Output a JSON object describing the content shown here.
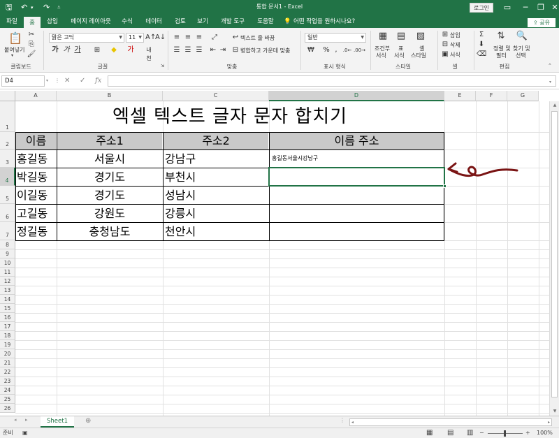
{
  "titlebar": {
    "title": "통합 문서1 - Excel",
    "login": "로그인",
    "save_icon": "save-icon",
    "undo_icon": "undo-icon",
    "redo_icon": "redo-icon"
  },
  "tabs": [
    "파일",
    "홈",
    "삽입",
    "페이지 레이아웃",
    "수식",
    "데이터",
    "검토",
    "보기",
    "개발 도구",
    "도움말"
  ],
  "tellme": "어떤 작업을 원하시나요?",
  "share": "공유",
  "ribbon": {
    "paste": "붙여넣기",
    "font_name": "맑은 고딕",
    "font_size": "11",
    "wrap_text": "텍스트 줄 바꿈",
    "merge_center": "병합하고 가운데 맞춤",
    "number_format": "일반",
    "cond_format": "조건부",
    "cond_format2": "서식",
    "format_table": "표",
    "format_table2": "서식",
    "cell_styles": "셀",
    "cell_styles2": "스타일",
    "insert": "삽입",
    "delete": "삭제",
    "format": "서식",
    "sort_filter": "정렬 및",
    "sort_filter2": "필터",
    "find_select": "찾기 및",
    "find_select2": "선택",
    "groups": {
      "clipboard": "클립보드",
      "font": "글꼴",
      "alignment": "맞춤",
      "number": "표시 형식",
      "styles": "스타일",
      "cells": "셀",
      "editing": "편집"
    }
  },
  "formula_bar": {
    "name_box": "D4",
    "formula": ""
  },
  "columns": [
    "A",
    "B",
    "C",
    "D",
    "E",
    "F",
    "G"
  ],
  "rows": [
    "1",
    "2",
    "3",
    "4",
    "5",
    "6",
    "7",
    "8",
    "9",
    "10",
    "11",
    "12",
    "13",
    "14",
    "15",
    "16",
    "17",
    "18",
    "19",
    "20",
    "21",
    "22",
    "23",
    "24",
    "25",
    "26"
  ],
  "sheet": {
    "title": "엑셀 텍스트 글자 문자 합치기",
    "headers": [
      "이름",
      "주소1",
      "주소2",
      "이름 주소"
    ],
    "data": [
      [
        "홍길동",
        "서울시",
        "강남구",
        "홍길동서울시강남구"
      ],
      [
        "박길동",
        "경기도",
        "부천시",
        ""
      ],
      [
        "이길동",
        "경기도",
        "성남시",
        ""
      ],
      [
        "고길동",
        "강원도",
        "강릉시",
        ""
      ],
      [
        "정길동",
        "충청남도",
        "천안시",
        ""
      ]
    ]
  },
  "sheet_tab": "Sheet1",
  "status": {
    "ready": "준비",
    "zoom": "100%"
  },
  "annotation": {
    "arrow_color": "#7a1414"
  }
}
